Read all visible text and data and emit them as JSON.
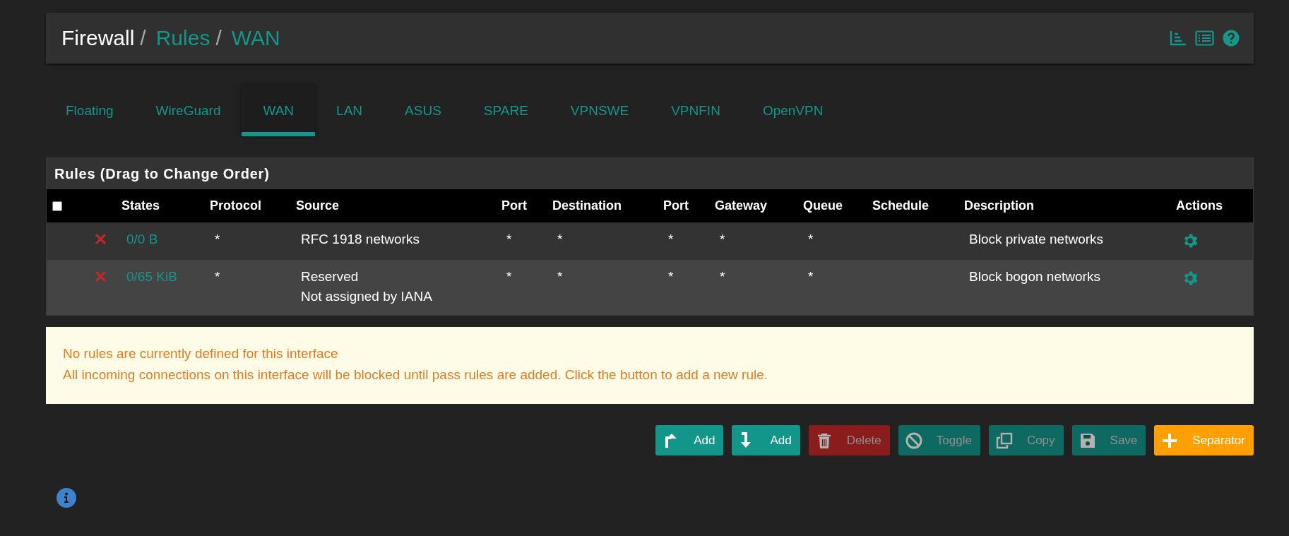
{
  "breadcrumb": [
    {
      "kind": "title",
      "label": "Firewall"
    },
    {
      "kind": "separator",
      "label": "/"
    },
    {
      "kind": "link",
      "label": "Rules"
    },
    {
      "kind": "separator",
      "label": "/"
    },
    {
      "kind": "link",
      "label": "WAN"
    }
  ],
  "tabs": [
    {
      "label": "Floating",
      "selected": false
    },
    {
      "label": "WireGuard",
      "selected": false
    },
    {
      "label": "WAN",
      "selected": true
    },
    {
      "label": "LAN",
      "selected": false
    },
    {
      "label": "ASUS",
      "selected": false
    },
    {
      "label": "SPARE",
      "selected": false
    },
    {
      "label": "VPNSWE",
      "selected": false
    },
    {
      "label": "VPNFIN",
      "selected": false
    },
    {
      "label": "OpenVPN",
      "selected": false
    }
  ],
  "panel": {
    "title": "Rules (Drag to Change Order)",
    "select_all": {
      "checked": false
    },
    "columns": [
      "States",
      "Protocol",
      "Source",
      "Port",
      "Destination",
      "Port",
      "Gateway",
      "Queue",
      "Schedule",
      "Description",
      "Actions"
    ],
    "rows": [
      {
        "kind": "block",
        "states": "0/0 B",
        "protocol": "*",
        "source": [
          "RFC 1918 networks"
        ],
        "source_port": "*",
        "destination": "*",
        "destination_port": "*",
        "gateway": "*",
        "queue": "*",
        "description": "Block private networks"
      },
      {
        "kind": "block",
        "states": "0/65 KiB",
        "protocol": "*",
        "source": [
          "Reserved",
          "Not assigned by IANA"
        ],
        "source_port": "*",
        "destination": "*",
        "destination_port": "*",
        "gateway": "*",
        "queue": "*",
        "description": "Block bogon networks"
      }
    ]
  },
  "alert": {
    "title": "No rules are currently defined for this interface",
    "message": "All incoming connections on this interface will be blocked until pass rules are added. Click the button to add a new rule."
  },
  "buttons": [
    {
      "kind": "add-top",
      "label": "Add",
      "disabled": false
    },
    {
      "kind": "add-bottom",
      "label": "Add",
      "disabled": false
    },
    {
      "kind": "delete",
      "label": "Delete",
      "disabled": true
    },
    {
      "kind": "toggle",
      "label": "Toggle",
      "disabled": true
    },
    {
      "kind": "copy",
      "label": "Copy",
      "disabled": true
    },
    {
      "kind": "save",
      "label": "Save",
      "disabled": true
    },
    {
      "kind": "separator",
      "label": "Separator",
      "disabled": false
    }
  ]
}
